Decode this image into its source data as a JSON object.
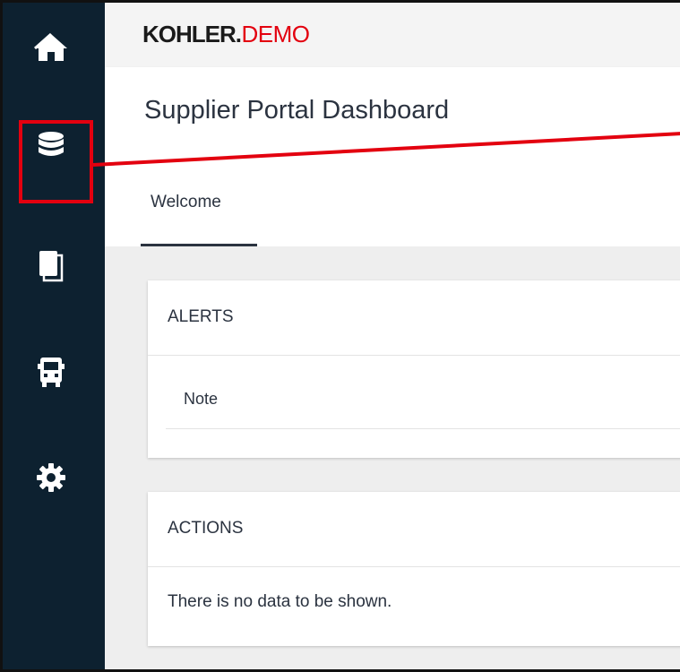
{
  "brand": {
    "name": "KOHLER",
    "dot": ".",
    "suffix": "DEMO"
  },
  "page": {
    "title": "Supplier Portal Dashboard"
  },
  "tabs": [
    {
      "label": "Welcome",
      "active": true
    }
  ],
  "sidebar": {
    "items": [
      {
        "icon": "home-icon"
      },
      {
        "icon": "database-icon",
        "highlighted": true
      },
      {
        "icon": "documents-icon"
      },
      {
        "icon": "truck-icon"
      },
      {
        "icon": "gear-icon"
      }
    ]
  },
  "alerts": {
    "heading": "ALERTS",
    "rows": [
      {
        "label": "Note"
      }
    ]
  },
  "actions": {
    "heading": "ACTIONS",
    "empty_message": "There is no data to be shown."
  },
  "colors": {
    "sidebar_bg": "#0d2130",
    "highlight": "#e3000f",
    "brand_accent": "#e3000f",
    "text": "#2b3340"
  }
}
